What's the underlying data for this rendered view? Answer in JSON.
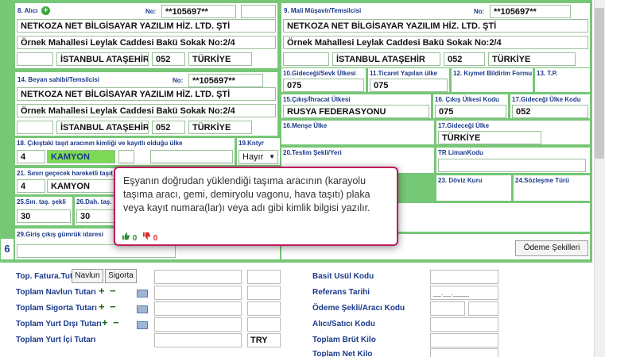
{
  "alici": {
    "label": "8. Alıcı",
    "no_label": "No:",
    "no_value": "**105697**",
    "name": "NETKOZA NET BİLGİSAYAR YAZILIM HİZ. LTD. ŞTİ",
    "address": "Örnek Mahallesi Leylak Caddesi Bakü Sokak No:2/4",
    "city": "İSTANBUL ATAŞEHİR",
    "code": "052",
    "country": "TÜRKİYE"
  },
  "mali": {
    "label": "9. Mali Müşavir/Temsilcisi",
    "no_label": "No:",
    "no_value": "**105697**",
    "name": "NETKOZA NET BİLGİSAYAR YAZILIM HİZ. LTD. ŞTİ",
    "address": "Örnek Mahallesi Leylak Caddesi Bakü Sokak No:2/4",
    "city": "İSTANBUL ATAŞEHİR",
    "code": "052",
    "country": "TÜRKİYE"
  },
  "beyan": {
    "label": "14. Beyan sahibi/Temsilcisi",
    "no_label": "No:",
    "no_value": "**105697**",
    "name": "NETKOZA NET BİLGİSAYAR YAZILIM HİZ. LTD. ŞTİ",
    "address": "Örnek Mahallesi Leylak Caddesi Bakü Sokak No:2/4",
    "city": "İSTANBUL ATAŞEHİR",
    "code": "052",
    "country": "TÜRKİYE"
  },
  "fields": {
    "f10_label": "10.Gideceği/Sevk Ülkesi",
    "f10_value": "075",
    "f11_label": "11.Ticaret Yapılan ülke",
    "f11_value": "075",
    "f12_label": "12. Kıymet Bildirim Formu",
    "f13_label": "13. T.P.",
    "f15_label": "15.Çıkış/İhracat Ülkesi",
    "f15_value": "RUSYA FEDERASYONU",
    "f16a_label": "16. Çıkış Ülkesi Kodu",
    "f16a_value": "075",
    "f17a_label": "17.Gideceği Ülke Kodu",
    "f17a_value": "052",
    "f16_label": "16.Menşe Ülke",
    "f17_label": "17.Gideceği Ülke",
    "f17_value": "TÜRKİYE",
    "f18_label": "18. Çıkıştaki taşıt aracının kimliği ve kayıtlı olduğu ülke",
    "f18_num": "4",
    "f18_value": "KAMYON",
    "f19_label": "19.Kntyr",
    "f19_value": "Hayır",
    "f20_label": "20.Teslim Şekli/Yeri",
    "tr_liman_label": "TR LimanKodu",
    "f21_label": "21. Sınırı geçecek hareketli taşıt",
    "f21_num": "4",
    "f21_value": "KAMYON",
    "f23_label": "23. Döviz Kuru",
    "f24_label": "24.Sözleşme Türü",
    "f25_label": "25.Sın. taş. şekli",
    "f25_value": "30",
    "f26_label": "26.Dah. taş.",
    "f26_value": "30",
    "f29_label": "29.Giriş çıkış gümrük idaresi",
    "row_number": "6",
    "odeme_button": "Ödeme Şekilleri"
  },
  "bottom": {
    "top_fatura": "Top. Fatura.Tut",
    "navlun_btn": "Navlun",
    "sigorta_btn": "Sigorta",
    "navlun": "Toplam Navlun Tutarı",
    "sigorta": "Toplam Sigorta Tutarı",
    "yurt_disi": "Toplam Yurt Dışı Tutarı",
    "yurt_ici": "Toplam Yurt İçi Tutarı",
    "currency": "TRY",
    "basit_usul": "Basit Usül Kodu",
    "referans": "Referans Tarihi",
    "referans_placeholder": "__.__.____",
    "odeme_sekli": "Ödeme Şekli/Aracı Kodu",
    "alici_satici": "Alıcı/Satıcı Kodu",
    "brut_kilo": "Toplam Brüt Kilo",
    "net_kilo": "Toplam Net Kilo",
    "plus": "+",
    "minus": "−"
  },
  "tooltip": {
    "text": "Eşyanın doğrudan yüklendiği taşıma aracının (karayolu taşıma aracı, gemi, demiryolu vagonu, hava taşıtı) plaka veya kayıt numara(lar)ı veya adı gibi kimlik bilgisi yazılır.",
    "like_count": "0",
    "dislike_count": "0"
  },
  "colors": {
    "panel": "#76c776",
    "label": "#1b3a8a",
    "tooltip_border": "#c2185b",
    "highlight": "#7ed957"
  }
}
